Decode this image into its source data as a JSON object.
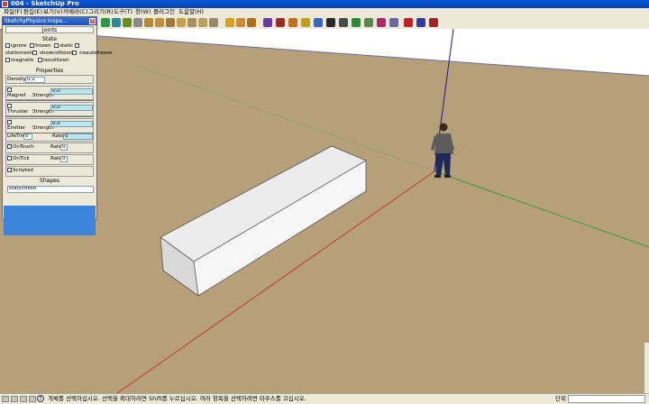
{
  "window": {
    "title": "004 - SketchUp Pro"
  },
  "menu": [
    "파일(F)",
    "편집(E)",
    "보기(V)",
    "카메라(C)",
    "그리기(R)",
    "도구(T)",
    "창(W)",
    "플러그인",
    "도움말(H)"
  ],
  "panel": {
    "title": "SketchyPhysics Inspe...",
    "close_glyph": "x",
    "joints_header": "Joints",
    "state_header": "State",
    "state_row1": [
      "ignore",
      "frozen",
      "static"
    ],
    "state_row2": [
      "staticmesh",
      "showcollision",
      "noautofreeze"
    ],
    "state_row3": [
      "magnetic",
      "nocollision"
    ],
    "properties_header": "Properties",
    "density_label": "Density",
    "density_value": "0.2",
    "magnet_label": "Magnet",
    "thruster_label": "Thruster",
    "emitter_label": "Emitter",
    "strength_label": "Strength",
    "magnet_strength": "0.0",
    "thruster_strength": "0.0",
    "emitter_strength": "0.0",
    "lifetime_label": "LifeTime",
    "lifetime_value": "0",
    "rate_label": "Rate",
    "emitter_rate": "0",
    "ontouch_label": "OnTouch",
    "ontouch_rate": "0",
    "ontick_label": "OnTick",
    "ontick_rate": "0",
    "scripted_label": "Scripted",
    "shapes_header": "Shapes",
    "shape_value": "staticmesh"
  },
  "status": {
    "help_glyph": "?",
    "message": "개체를 선택하십시오. 선택을 확대하려면 Shift를 누르십시오. 여러 항목을 선택하려면 마우스를 끄십시오.",
    "units_label": "단위"
  },
  "colors": {
    "ground": "#b6a07a",
    "sky": "#ffffff",
    "axis_red": "#c0392b",
    "axis_green": "#3a9a3a",
    "axis_blue": "#1a1a8a",
    "box_top": "#ececec",
    "box_front": "#d9d9d9",
    "box_side": "#f6f6f6"
  }
}
